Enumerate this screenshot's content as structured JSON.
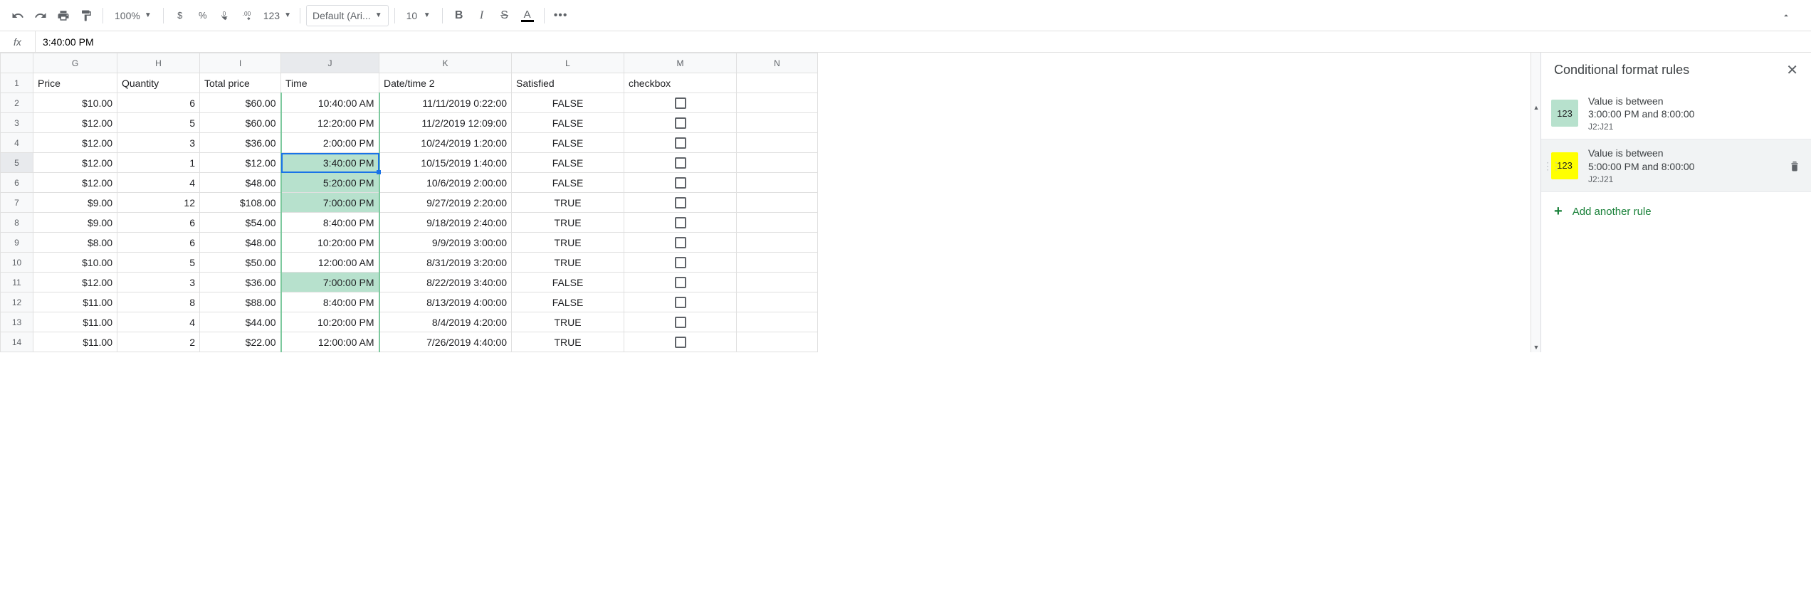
{
  "toolbar": {
    "zoom": "100%",
    "currency": "$",
    "percent": "%",
    "dec_dec": ".0",
    "inc_dec": ".00",
    "numfmt": "123",
    "font": "Default (Ari...",
    "size": "10",
    "more": "•••"
  },
  "fx": {
    "label": "fx",
    "value": "3:40:00 PM"
  },
  "columns": [
    "G",
    "H",
    "I",
    "J",
    "K",
    "L",
    "M",
    "N"
  ],
  "headers": {
    "G": "Price",
    "H": "Quantity",
    "I": "Total price",
    "J": "Time",
    "K": "Date/time 2",
    "L": "Satisfied",
    "M": "checkbox",
    "N": ""
  },
  "rows": [
    {
      "n": 2,
      "G": "$10.00",
      "H": "6",
      "I": "$60.00",
      "J": "10:40:00 AM",
      "K": "11/11/2019 0:22:00",
      "L": "FALSE",
      "cf": "border"
    },
    {
      "n": 3,
      "G": "$12.00",
      "H": "5",
      "I": "$60.00",
      "J": "12:20:00 PM",
      "K": "11/2/2019 12:09:00",
      "L": "FALSE",
      "cf": "border"
    },
    {
      "n": 4,
      "G": "$12.00",
      "H": "3",
      "I": "$36.00",
      "J": "2:00:00 PM",
      "K": "10/24/2019 1:20:00",
      "L": "FALSE",
      "cf": "border"
    },
    {
      "n": 5,
      "G": "$12.00",
      "H": "1",
      "I": "$12.00",
      "J": "3:40:00 PM",
      "K": "10/15/2019 1:40:00",
      "L": "FALSE",
      "cf": "green",
      "sel": true
    },
    {
      "n": 6,
      "G": "$12.00",
      "H": "4",
      "I": "$48.00",
      "J": "5:20:00 PM",
      "K": "10/6/2019 2:00:00",
      "L": "FALSE",
      "cf": "green"
    },
    {
      "n": 7,
      "G": "$9.00",
      "H": "12",
      "I": "$108.00",
      "J": "7:00:00 PM",
      "K": "9/27/2019 2:20:00",
      "L": "TRUE",
      "cf": "green"
    },
    {
      "n": 8,
      "G": "$9.00",
      "H": "6",
      "I": "$54.00",
      "J": "8:40:00 PM",
      "K": "9/18/2019 2:40:00",
      "L": "TRUE",
      "cf": "border"
    },
    {
      "n": 9,
      "G": "$8.00",
      "H": "6",
      "I": "$48.00",
      "J": "10:20:00 PM",
      "K": "9/9/2019 3:00:00",
      "L": "TRUE",
      "cf": "border"
    },
    {
      "n": 10,
      "G": "$10.00",
      "H": "5",
      "I": "$50.00",
      "J": "12:00:00 AM",
      "K": "8/31/2019 3:20:00",
      "L": "TRUE",
      "cf": "border"
    },
    {
      "n": 11,
      "G": "$12.00",
      "H": "3",
      "I": "$36.00",
      "J": "7:00:00 PM",
      "K": "8/22/2019 3:40:00",
      "L": "FALSE",
      "cf": "green"
    },
    {
      "n": 12,
      "G": "$11.00",
      "H": "8",
      "I": "$88.00",
      "J": "8:40:00 PM",
      "K": "8/13/2019 4:00:00",
      "L": "FALSE",
      "cf": "border"
    },
    {
      "n": 13,
      "G": "$11.00",
      "H": "4",
      "I": "$44.00",
      "J": "10:20:00 PM",
      "K": "8/4/2019 4:20:00",
      "L": "TRUE",
      "cf": "border"
    },
    {
      "n": 14,
      "G": "$11.00",
      "H": "2",
      "I": "$22.00",
      "J": "12:00:00 AM",
      "K": "7/26/2019 4:40:00",
      "L": "TRUE",
      "cf": "border"
    }
  ],
  "panel": {
    "title": "Conditional format rules",
    "rules": [
      {
        "swatch_bg": "#b7e1cd",
        "swatch_text": "123",
        "title": "Value is between",
        "title2": "3:00:00 PM and 8:00:00",
        "range": "J2:J21"
      },
      {
        "swatch_bg": "#ffff00",
        "swatch_text": "123",
        "title": "Value is between",
        "title2": "5:00:00 PM and 8:00:00",
        "range": "J2:J21",
        "hover": true
      }
    ],
    "add_label": "Add another rule"
  }
}
